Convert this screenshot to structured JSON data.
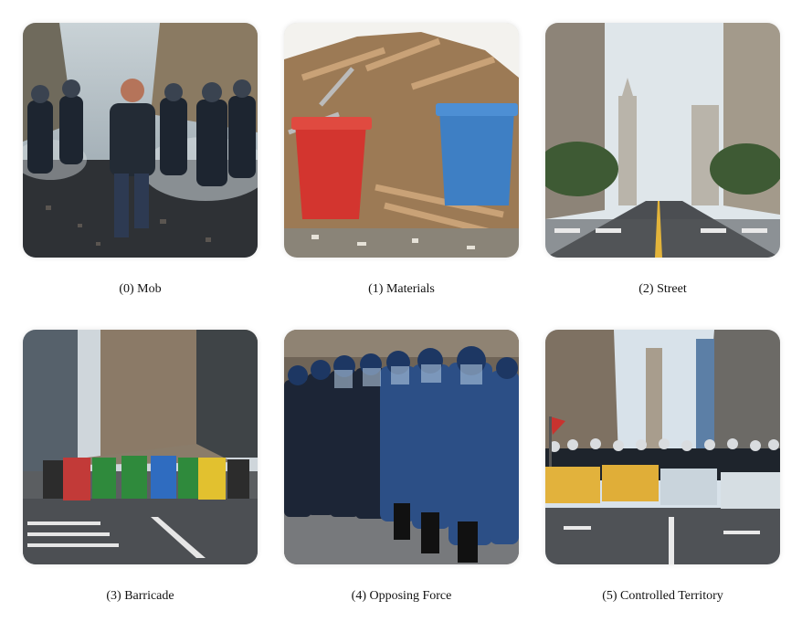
{
  "panels": [
    {
      "caption": "(0) Mob",
      "scene": "mob"
    },
    {
      "caption": "(1) Materials",
      "scene": "materials"
    },
    {
      "caption": "(2) Street",
      "scene": "street"
    },
    {
      "caption": "(3) Barricade",
      "scene": "barricade"
    },
    {
      "caption": "(4) Opposing Force",
      "scene": "opposing-force"
    },
    {
      "caption": "(5) Controlled Territory",
      "scene": "controlled-territory"
    }
  ]
}
